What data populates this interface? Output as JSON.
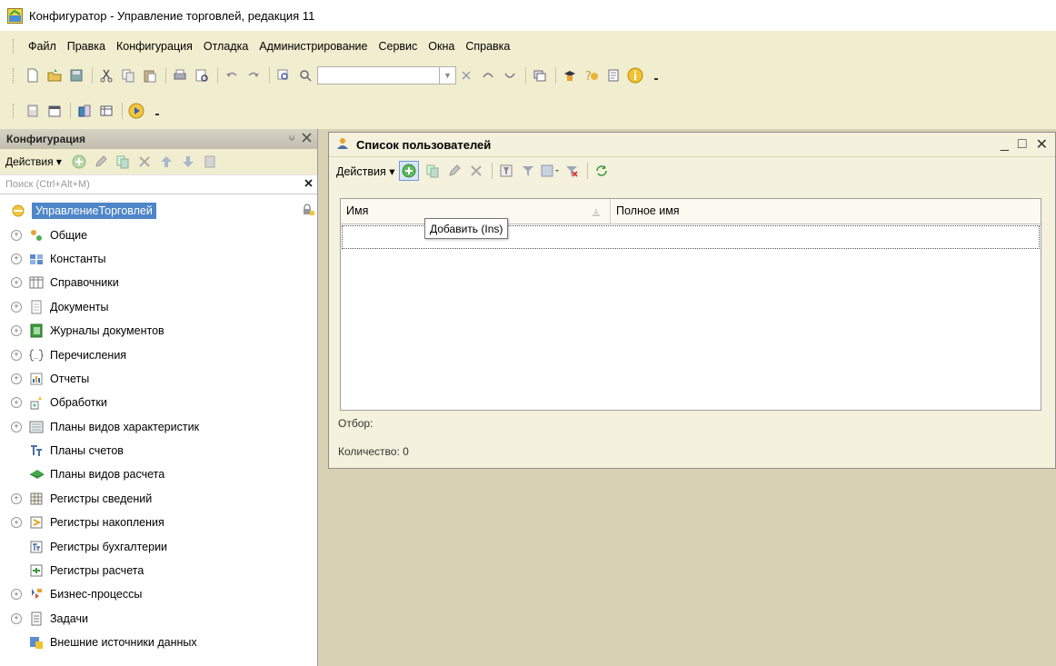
{
  "window": {
    "title": "Конфигуратор - Управление торговлей, редакция 11"
  },
  "menu": {
    "items": [
      "Файл",
      "Правка",
      "Конфигурация",
      "Отладка",
      "Администрирование",
      "Сервис",
      "Окна",
      "Справка"
    ]
  },
  "config_panel": {
    "title": "Конфигурация",
    "actions_label": "Действия",
    "search_placeholder": "Поиск (Ctrl+Alt+M)",
    "root": "УправлениеТорговлей",
    "tree": [
      {
        "label": "Общие",
        "icon": "general-icon",
        "expandable": true
      },
      {
        "label": "Константы",
        "icon": "constants-icon",
        "expandable": true
      },
      {
        "label": "Справочники",
        "icon": "catalogs-icon",
        "expandable": true
      },
      {
        "label": "Документы",
        "icon": "documents-icon",
        "expandable": true
      },
      {
        "label": "Журналы документов",
        "icon": "journals-icon",
        "expandable": true
      },
      {
        "label": "Перечисления",
        "icon": "enums-icon",
        "expandable": true
      },
      {
        "label": "Отчеты",
        "icon": "reports-icon",
        "expandable": true
      },
      {
        "label": "Обработки",
        "icon": "dataprocessors-icon",
        "expandable": true
      },
      {
        "label": "Планы видов характеристик",
        "icon": "chart-of-characteristics-icon",
        "expandable": true
      },
      {
        "label": "Планы счетов",
        "icon": "chart-of-accounts-icon",
        "expandable": false
      },
      {
        "label": "Планы видов расчета",
        "icon": "chart-of-calculation-icon",
        "expandable": false
      },
      {
        "label": "Регистры сведений",
        "icon": "info-registers-icon",
        "expandable": true
      },
      {
        "label": "Регистры накопления",
        "icon": "accumulation-registers-icon",
        "expandable": true
      },
      {
        "label": "Регистры бухгалтерии",
        "icon": "accounting-registers-icon",
        "expandable": false
      },
      {
        "label": "Регистры расчета",
        "icon": "calculation-registers-icon",
        "expandable": false
      },
      {
        "label": "Бизнес-процессы",
        "icon": "business-processes-icon",
        "expandable": true
      },
      {
        "label": "Задачи",
        "icon": "tasks-icon",
        "expandable": true
      },
      {
        "label": "Внешние источники данных",
        "icon": "external-sources-icon",
        "expandable": false
      }
    ]
  },
  "users_window": {
    "title": "Список пользователей",
    "actions_label": "Действия",
    "columns": [
      "Имя",
      "Полное имя"
    ],
    "tooltip": "Добавить (Ins)",
    "filter_label": "Отбор:",
    "count_label": "Количество: 0"
  }
}
